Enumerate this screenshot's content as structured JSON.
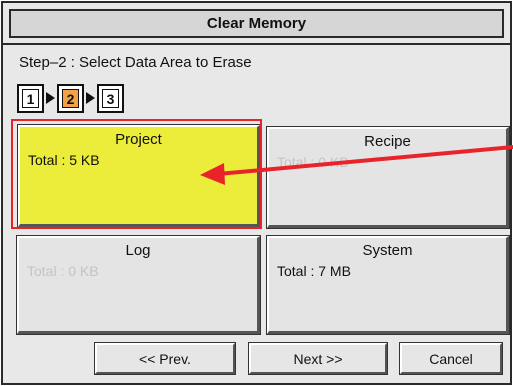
{
  "dialog": {
    "title": "Clear Memory",
    "step_label": "Step–2  :  Select Data Area to Erase"
  },
  "steps": [
    {
      "label": "1",
      "active": false
    },
    {
      "label": "2",
      "active": true
    },
    {
      "label": "3",
      "active": false
    }
  ],
  "areas": {
    "project": {
      "name": "Project",
      "total": "Total  :  5 KB",
      "selected": true,
      "enabled": true
    },
    "recipe": {
      "name": "Recipe",
      "total": "Total  :  0 KB",
      "selected": false,
      "enabled": false
    },
    "log": {
      "name": "Log",
      "total": "Total  :  0 KB",
      "selected": false,
      "enabled": false
    },
    "system": {
      "name": "System",
      "total": "Total  :  7 MB",
      "selected": false,
      "enabled": true
    }
  },
  "buttons": {
    "prev": "<<  Prev.",
    "next": "Next  >>",
    "cancel": "Cancel"
  },
  "colors": {
    "selected_tile": "#ecec3a",
    "active_step": "#f2a148",
    "highlight_frame": "#e8232a",
    "annotation_arrow": "#e8232a"
  }
}
